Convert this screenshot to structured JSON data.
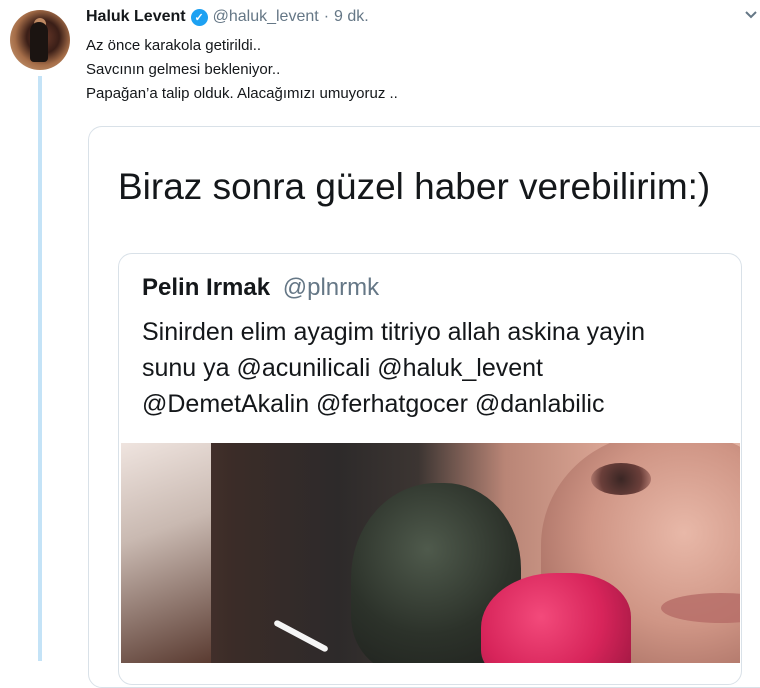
{
  "tweet": {
    "author_name": "Haluk Levent",
    "author_handle": "@haluk_levent",
    "separator": "·",
    "time": "9 dk.",
    "verified_icon": "verified-badge-icon",
    "lines": [
      "Az önce karakola getirildi..",
      "Savcının gelmesi bekleniyor..",
      "Papağan’a talip olduk. Alacağımızı umuyoruz .."
    ]
  },
  "quote": {
    "text": "Biraz sonra güzel haber verebilirim:)",
    "inner": {
      "author_name": "Pelin Irmak",
      "author_handle": "@plnrmk",
      "lines": [
        "Sinirden elim ayagim titriyo allah askina yayin",
        "sunu ya @acunilicali @haluk_levent",
        "@DemetAkalin @ferhatgocer @danlabilic"
      ]
    }
  },
  "colors": {
    "accent": "#1da1f2",
    "muted": "#657786",
    "thread_line": "#c4e3f7",
    "border": "#d9e1e8"
  }
}
